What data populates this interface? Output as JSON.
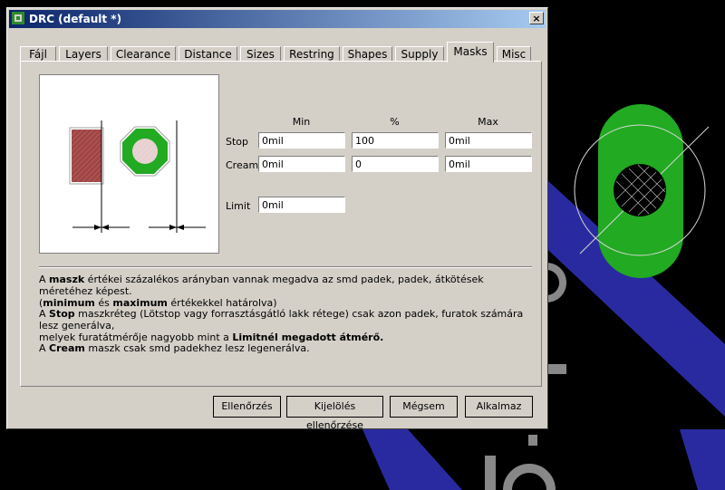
{
  "window": {
    "title": "DRC (default *)",
    "close_label": "×"
  },
  "tabs": [
    {
      "label": "Fájl",
      "active": false
    },
    {
      "label": "Layers",
      "active": false
    },
    {
      "label": "Clearance",
      "active": false
    },
    {
      "label": "Distance",
      "active": false
    },
    {
      "label": "Sizes",
      "active": false
    },
    {
      "label": "Restring",
      "active": false
    },
    {
      "label": "Shapes",
      "active": false
    },
    {
      "label": "Supply",
      "active": false
    },
    {
      "label": "Masks",
      "active": true
    },
    {
      "label": "Misc",
      "active": false
    }
  ],
  "masks": {
    "columns": {
      "min": "Min",
      "percent": "%",
      "max": "Max"
    },
    "rows": {
      "stop": {
        "label": "Stop",
        "min": "0mil",
        "percent": "100",
        "max": "0mil"
      },
      "cream": {
        "label": "Cream",
        "min": "0mil",
        "percent": "0",
        "max": "0mil"
      }
    },
    "limit": {
      "label": "Limit",
      "value": "0mil"
    }
  },
  "description": {
    "p1": {
      "a": "A ",
      "b1": "maszk",
      "c": " értékei százalékos arányban vannak megadva az smd padek, padek, átkötések méretéhez képest.",
      "d": "(",
      "b2": "minimum",
      "e": " és ",
      "b3": "maximum",
      "f": " értékekkel határolva)"
    },
    "p2": {
      "a": "A ",
      "b1": "Stop",
      "c": " maszkréteg (Lötstop vagy forrasztásgátló lakk rétege) csak azon padek, furatok számára lesz generálva,",
      "d": "melyek furatátmérője nagyobb mint a ",
      "b2": "Limitnél megadott átmérő."
    },
    "p3": {
      "a": "A ",
      "b1": "Cream",
      "c": " maszk csak smd padekhez lesz legenerálva."
    }
  },
  "buttons": {
    "check": "Ellenőrzés",
    "check_selection": "Kijelölés ellenőrzése",
    "cancel": "Mégsem",
    "apply": "Alkalmaz"
  },
  "colors": {
    "pcb_background": "#000000",
    "trace_blue": "#2a2aa0",
    "pad_green": "#22aa22",
    "smd_pad_red": "#a04040",
    "title_blue": "#0a246a"
  }
}
